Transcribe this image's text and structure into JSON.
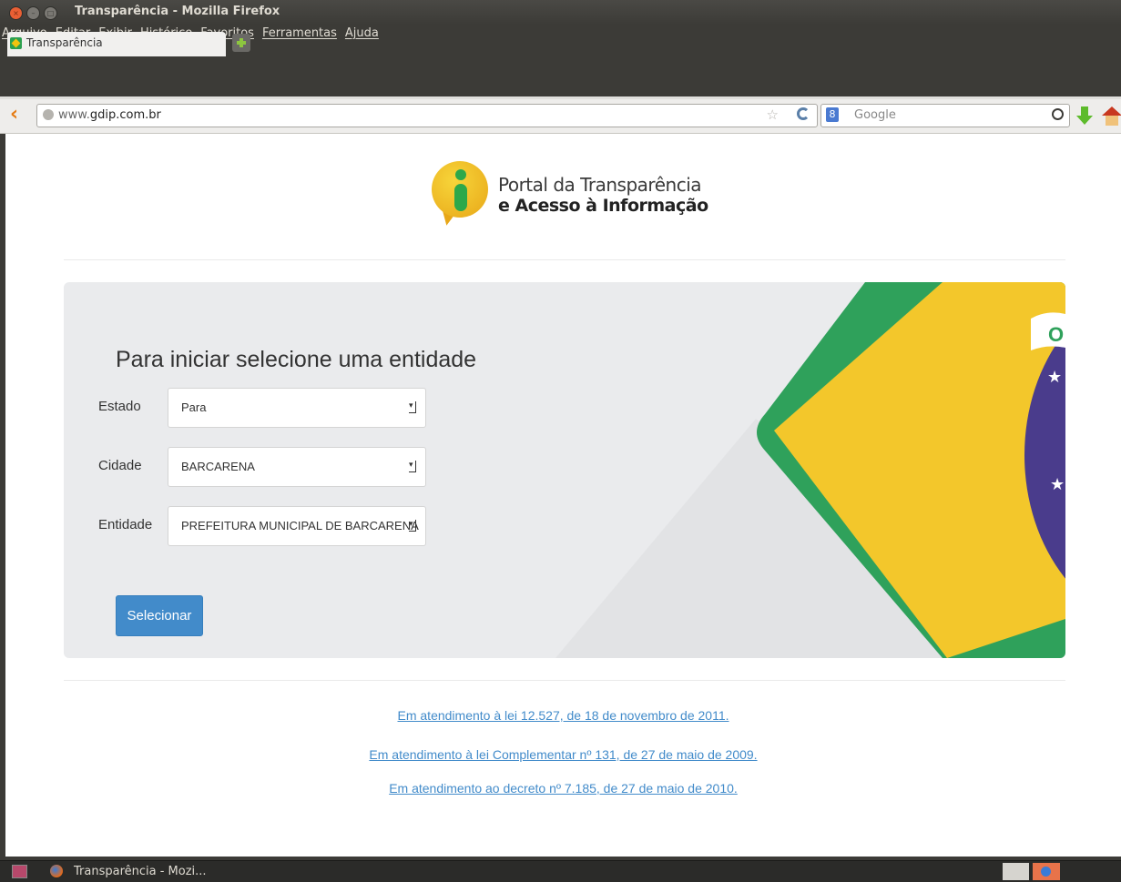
{
  "window": {
    "title": "Transparência - Mozilla Firefox"
  },
  "menubar": {
    "items": [
      "Arquivo",
      "Editar",
      "Exibir",
      "Histórico",
      "Favoritos",
      "Ferramentas",
      "Ajuda"
    ]
  },
  "tabs": [
    {
      "label": "Transparência",
      "active": true
    }
  ],
  "navbar": {
    "url_prefix": "www.",
    "url_domain": "gdip.com.br",
    "search_placeholder": "Google"
  },
  "header": {
    "logo_line1": "Portal da Transparência",
    "logo_line2": "e Acesso à Informação"
  },
  "form": {
    "title": "Para iniciar selecione uma entidade",
    "fields": [
      {
        "label": "Estado",
        "value": "Para"
      },
      {
        "label": "Cidade",
        "value": "BARCARENA"
      },
      {
        "label": "Entidade",
        "value": "PREFEITURA MUNICIPAL DE BARCARENA"
      }
    ],
    "submit_label": "Selecionar"
  },
  "footer_links": [
    "Em atendimento à lei 12.527, de 18 de novembro de 2011.",
    "Em atendimento à lei Complementar nº 131, de 27 de maio de 2009.",
    "Em atendimento ao decreto nº 7.185, de 27 de maio de 2010."
  ],
  "taskbar": {
    "item_label": "Transparência - Mozi..."
  },
  "colors": {
    "flag_green": "#2fa15b",
    "flag_yellow": "#f3c72b",
    "flag_blue": "#4a3c8c",
    "button_blue": "#428bca",
    "link_blue": "#428bca"
  }
}
